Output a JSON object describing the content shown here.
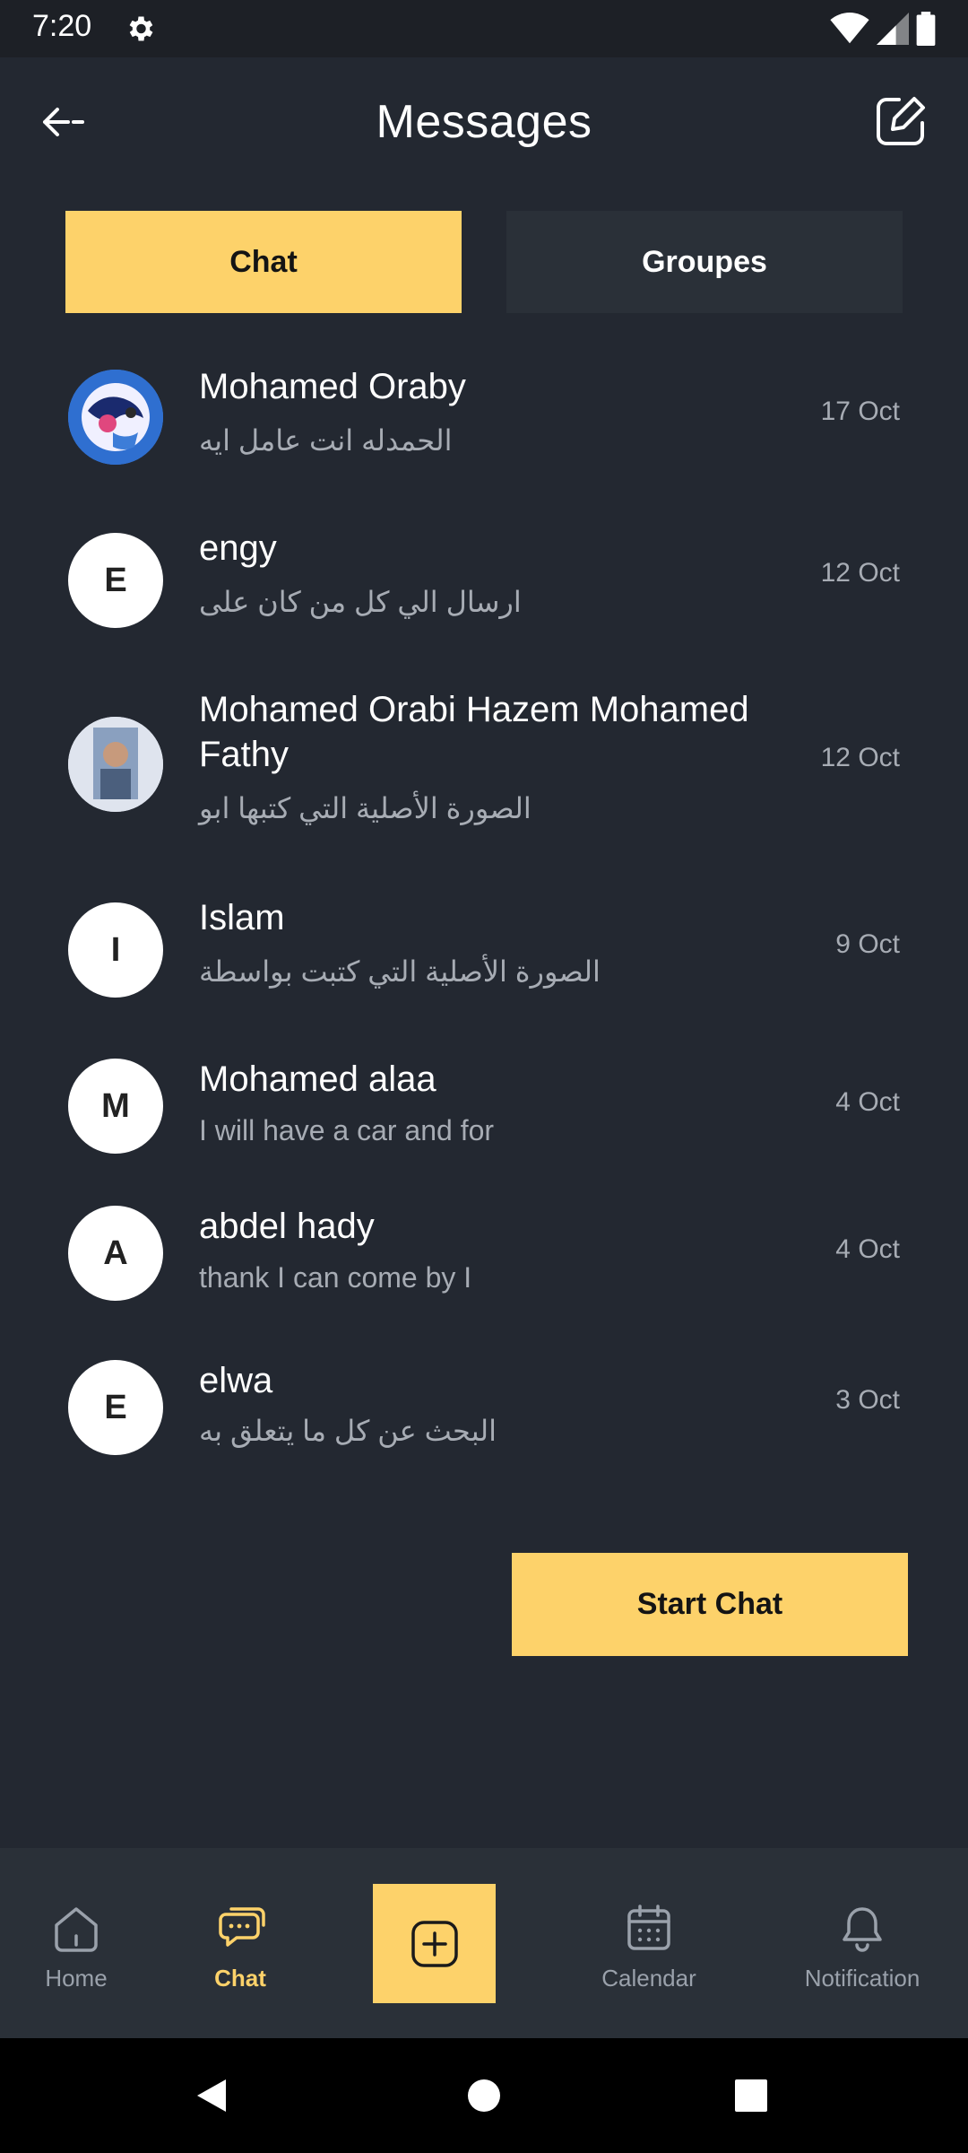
{
  "status_bar": {
    "time": "7:20"
  },
  "header": {
    "title": "Messages"
  },
  "tabs": [
    {
      "label": "Chat"
    },
    {
      "label": "Groupes"
    }
  ],
  "conversations": [
    {
      "name": "Mohamed Oraby",
      "preview": "الحمدله انت عامل ايه",
      "date": "17 Oct",
      "avatar": "photo"
    },
    {
      "name": "engy",
      "preview": "ارسال الي كل من كان على",
      "date": "12 Oct",
      "avatar_letter": "E"
    },
    {
      "name": "Mohamed Orabi Hazem Mohamed Fathy",
      "preview": "الصورة الأصلية التي كتبها ابو",
      "date": "12 Oct",
      "avatar": "photo"
    },
    {
      "name": "Islam",
      "preview": "الصورة الأصلية التي كتبت بواسطة",
      "date": "9 Oct",
      "avatar_letter": "I"
    },
    {
      "name": "Mohamed alaa",
      "preview": "I will have a car and for",
      "date": "4 Oct",
      "avatar_letter": "M"
    },
    {
      "name": "abdel hady",
      "preview": "thank I can come by I",
      "date": "4 Oct",
      "avatar_letter": "A"
    },
    {
      "name": "elwa",
      "preview": "البحث عن كل ما يتعلق به",
      "date": "3 Oct",
      "avatar_letter": "E"
    }
  ],
  "start_chat_label": "Start Chat",
  "bottom_nav": {
    "home": "Home",
    "chat": "Chat",
    "calendar": "Calendar",
    "notification": "Notification"
  },
  "colors": {
    "background": "#232831",
    "accent": "#fdd26a",
    "panel": "#2a3038",
    "muted_text": "#a7acb4"
  }
}
